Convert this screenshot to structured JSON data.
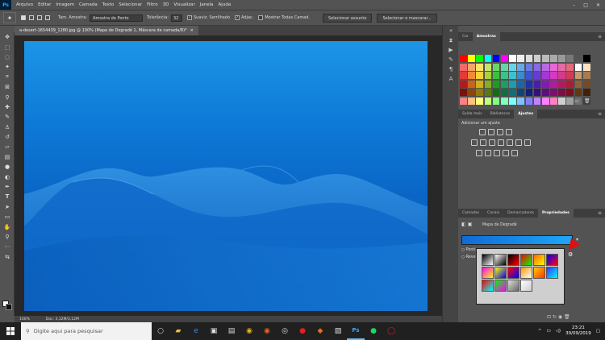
{
  "menubar": {
    "logo": "Ps",
    "items": [
      "Arquivo",
      "Editar",
      "Imagem",
      "Camada",
      "Texto",
      "Selecionar",
      "Filtro",
      "3D",
      "Visualizar",
      "Janela",
      "Ajuda"
    ],
    "window_buttons": [
      "–",
      "□",
      "✕"
    ]
  },
  "options": {
    "sample_size_label": "Tam. Amostra:",
    "sample_size_value": "Amostra de Ponto",
    "tolerance_label": "Tolerância:",
    "tolerance_value": "32",
    "antialias_label": "Suaviz. Serrilhado",
    "contiguous_label": "Adjac.",
    "all_layers_label": "Mostrar Todas Camad.",
    "select_subject": "Selecionar assunto",
    "select_mask": "Selecionar e mascarar..."
  },
  "document": {
    "tab_title": "a-desert-1654439_1280.jpg @ 100% (Mapa de Degradê 1, Máscara de camada/8)*",
    "tab_close": "×",
    "zoom": "100%",
    "doc_info": "Doc: 3,12M/3,12M"
  },
  "swatches_panel": {
    "tabs": [
      "Cor",
      "Amostras"
    ],
    "active": 1,
    "colors": [
      "#ff0000",
      "#ffff00",
      "#00ff00",
      "#00ffff",
      "#0000ff",
      "#ff00ff",
      "#ffffff",
      "#eeeeee",
      "#dddddd",
      "#cccccc",
      "#bbbbbb",
      "#aaaaaa",
      "#999999",
      "#777777",
      "#555555",
      "#000000",
      "#f06a6a",
      "#f6a56a",
      "#f9e36a",
      "#c4e36a",
      "#6ad36a",
      "#6ad3a7",
      "#6ad3e3",
      "#6aa7e3",
      "#6a7ae3",
      "#8a6ae3",
      "#b96ae3",
      "#e36ad3",
      "#e36aa7",
      "#e36a7a",
      "#ffffff",
      "#ffe0c0",
      "#e23b3b",
      "#ef8a3b",
      "#f4d23b",
      "#a9d23b",
      "#3bc23b",
      "#3bc28a",
      "#3bc2d2",
      "#3b8ad2",
      "#3b54d2",
      "#6a3bd2",
      "#a33bd2",
      "#d23bc2",
      "#d23b8a",
      "#d23b54",
      "#c69c6d",
      "#a67c52",
      "#b31b1b",
      "#c6651b",
      "#cfb01b",
      "#84b01b",
      "#1b9f1b",
      "#1b9f65",
      "#1b9fb0",
      "#1b65b0",
      "#1b33b0",
      "#4d1bb0",
      "#821bb0",
      "#b01b9f",
      "#b01b65",
      "#b01b33",
      "#8c6239",
      "#754c24",
      "#7a1010",
      "#8a4510",
      "#8f7a10",
      "#5a7a10",
      "#107010",
      "#107045",
      "#10707a",
      "#10457a",
      "#10227a",
      "#35107a",
      "#5a107a",
      "#7a1070",
      "#7a1045",
      "#7a1022",
      "#603913",
      "#42210b",
      "#ff8080",
      "#ffc080",
      "#ffff80",
      "#c0ff80",
      "#80ff80",
      "#80ffc0",
      "#80ffff",
      "#80c0ff",
      "#8080ff",
      "#c080ff",
      "#ff80ff",
      "#ff80c0",
      "#d0d0d0",
      "#a0a0a0",
      "#707070",
      "#404040"
    ],
    "footer_icons": [
      "folder-icon",
      "trash-icon"
    ]
  },
  "adjustments_panel": {
    "tabs": [
      "Saída mais",
      "Bibliotecas",
      "Ajustes"
    ],
    "active": 2,
    "add_label": "Adicionar um ajuste",
    "row1_icons": [
      "brightness-icon",
      "levels-icon",
      "curves-icon",
      "exposure-icon"
    ],
    "row2_icons": [
      "vibrance-icon",
      "hue-saturation-icon",
      "color-balance-icon",
      "black-white-icon",
      "photo-filter-icon",
      "channel-mixer-icon",
      "color-lookup-icon"
    ],
    "row3_icons": [
      "invert-icon",
      "posterize-icon",
      "threshold-icon",
      "gradient-map-icon",
      "selective-color-icon"
    ]
  },
  "properties_panel": {
    "tabs": [
      "Camadas",
      "Canais",
      "Demarcadores",
      "Propriedades"
    ],
    "active": 3,
    "title": "Mapa de Degradê",
    "options": [
      "Ponti",
      "Reve"
    ],
    "gear": "⚙",
    "gradient_presets": [
      [
        "#000000",
        "#ffffff"
      ],
      [
        "#ffffff",
        "#000000"
      ],
      [
        "#000000",
        "#ff0000"
      ],
      [
        "#ff0000",
        "#00ff00"
      ],
      [
        "#ff6600",
        "#ffff00"
      ],
      [
        "#0000ff",
        "#ff0000"
      ],
      [
        "#ff00ff",
        "#ffff00"
      ],
      [
        "#ffff00",
        "#0000ff"
      ],
      [
        "#ff0000",
        "#0000ff"
      ],
      [
        "#ff9900",
        "#ffffff"
      ],
      [
        "#ffcc00",
        "#ff3300"
      ],
      [
        "#3333ff",
        "#00ffff"
      ],
      [
        "#ff0000",
        "#00ffff"
      ],
      [
        "#00ff00",
        "#ff00ff"
      ],
      [
        "#dddddd",
        "#666666"
      ],
      [
        "#ffffff",
        "#cccccc"
      ]
    ]
  },
  "taskbar": {
    "search_placeholder": "Digite aqui para pesquisar",
    "time": "23:21",
    "date": "30/09/2019",
    "apps": [
      "task-view-icon",
      "file-explorer-icon",
      "edge-icon",
      "store-icon",
      "media-icon",
      "chrome-icon",
      "firefox-icon",
      "obs-icon",
      "ccleaner-icon",
      "app-icon",
      "photos-icon",
      "photoshop-icon",
      "spotify-icon",
      "opera-icon"
    ]
  }
}
